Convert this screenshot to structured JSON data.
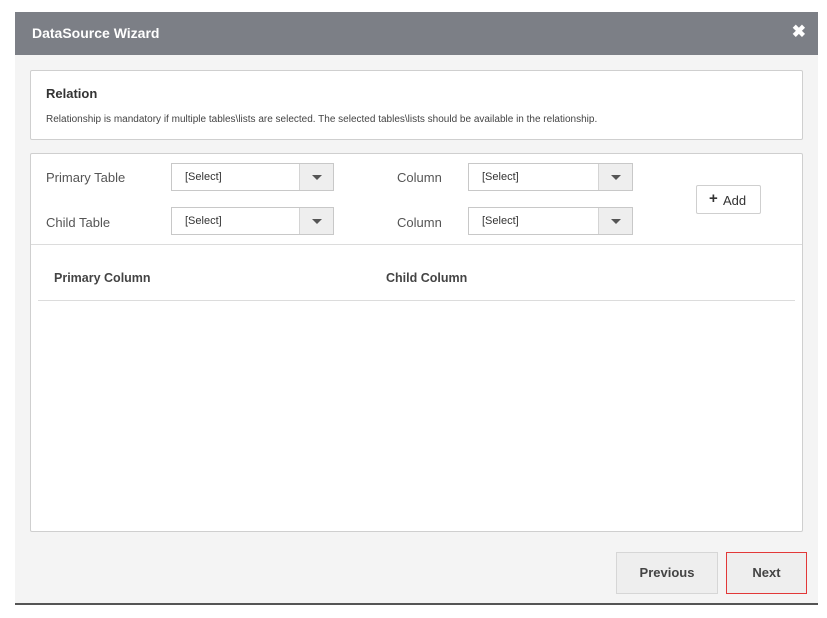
{
  "dialog": {
    "title": "DataSource Wizard",
    "close_symbol": "✖"
  },
  "relation": {
    "heading": "Relation",
    "description": "Relationship is mandatory if multiple tables\\lists are selected. The selected tables\\lists should be available in the relationship."
  },
  "form": {
    "primary_table_label": "Primary Table",
    "primary_table_value": "[Select]",
    "primary_column_label": "Column",
    "primary_column_value": "[Select]",
    "child_table_label": "Child Table",
    "child_table_value": "[Select]",
    "child_column_label": "Column",
    "child_column_value": "[Select]",
    "add_button_label": "Add"
  },
  "table": {
    "headers": [
      "Primary Column",
      "Child Column"
    ],
    "rows": []
  },
  "footer": {
    "previous_label": "Previous",
    "next_label": "Next"
  },
  "colors": {
    "titlebar": "#7c7f86",
    "next_focus_border": "#e23838"
  },
  "icons": {
    "close": "close-icon",
    "dropdown": "chevron-down-icon",
    "add": "plus-icon"
  }
}
